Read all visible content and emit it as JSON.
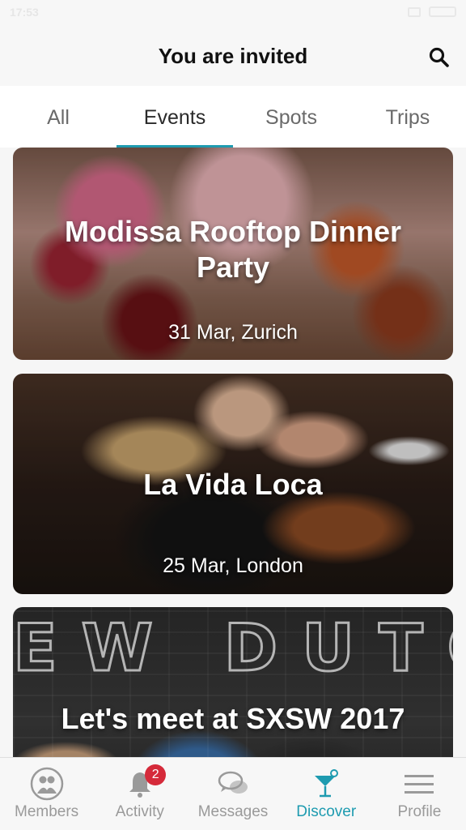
{
  "status": {
    "time": "17:53"
  },
  "header": {
    "title": "You are invited"
  },
  "tabs": [
    {
      "label": "All"
    },
    {
      "label": "Events"
    },
    {
      "label": "Spots"
    },
    {
      "label": "Trips"
    }
  ],
  "active_tab": "Events",
  "events": [
    {
      "title": "Modissa Rooftop Dinner Party",
      "subtitle": "31 Mar, Zurich"
    },
    {
      "title": "La Vida Loca",
      "subtitle": "25 Mar, London"
    },
    {
      "title": "Let's meet at SXSW 2017",
      "subtitle": ""
    }
  ],
  "nav": {
    "items": [
      {
        "label": "Members",
        "icon": "members-icon"
      },
      {
        "label": "Activity",
        "icon": "bell-icon",
        "badge": "2"
      },
      {
        "label": "Messages",
        "icon": "chat-bubbles-icon"
      },
      {
        "label": "Discover",
        "icon": "cocktail-icon"
      },
      {
        "label": "Profile",
        "icon": "menu-lines-icon"
      }
    ],
    "active": "Discover"
  },
  "colors": {
    "accent": "#1e9bb0",
    "badge": "#d52a3a",
    "inactive": "#9a9a9a"
  }
}
